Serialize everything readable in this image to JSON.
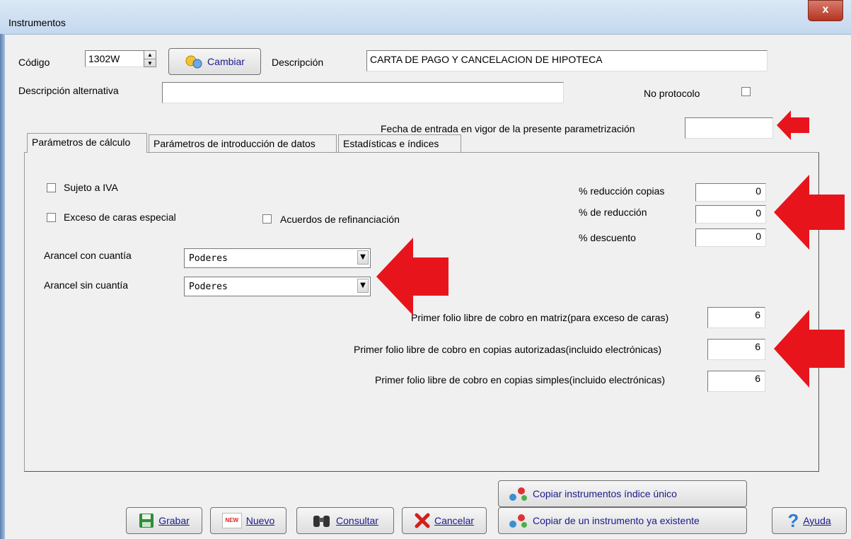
{
  "window": {
    "title": "Instrumentos",
    "close_glyph": "x"
  },
  "header": {
    "codigo_label": "Código",
    "codigo_value": "1302W",
    "cambiar_label": "Cambiar",
    "descripcion_label": "Descripción",
    "descripcion_value": "CARTA DE PAGO Y CANCELACION DE HIPOTECA",
    "desc_alt_label": "Descripción alternativa",
    "desc_alt_value": "",
    "no_protocolo_label": "No protocolo",
    "fecha_label": "Fecha de entrada en vigor de la presente parametrización",
    "fecha_value": ""
  },
  "tabs": [
    {
      "label": "Parámetros de cálculo"
    },
    {
      "label": "Parámetros de introducción de datos"
    },
    {
      "label": "Estadísticas e índices"
    }
  ],
  "calc": {
    "sujeto_iva": "Sujeto a IVA",
    "exceso_caras": "Exceso de caras especial",
    "acuerdos": "Acuerdos de refinanciación",
    "arancel_con_label": "Arancel con cuantía",
    "arancel_con_value": "Poderes",
    "arancel_sin_label": "Arancel sin cuantía",
    "arancel_sin_value": "Poderes",
    "red_copias_label": "% reducción copias",
    "red_copias_value": "0",
    "reduccion_label": "% de reducción",
    "reduccion_value": "0",
    "descuento_label": "% descuento",
    "descuento_value": "0",
    "folio_matriz_label": "Primer folio libre de cobro en matriz(para exceso de caras)",
    "folio_matriz_value": "6",
    "folio_autorizadas_label": "Primer folio libre de cobro en copias autorizadas(incluido electrónicas)",
    "folio_autorizadas_value": "6",
    "folio_simples_label": "Primer folio libre de cobro en copias simples(incluido electrónicas)",
    "folio_simples_value": "6"
  },
  "buttons": {
    "grabar": "Grabar",
    "nuevo": "Nuevo",
    "new_badge": "NEW",
    "consultar": "Consultar",
    "cancelar": "Cancelar",
    "copiar_indice": "Copiar instrumentos índice único",
    "copiar_existente": "Copiar de un instrumento ya existente",
    "ayuda": "Ayuda"
  },
  "colors": {
    "arrow": "#e8141c",
    "link_text": "#1a1a8c"
  }
}
